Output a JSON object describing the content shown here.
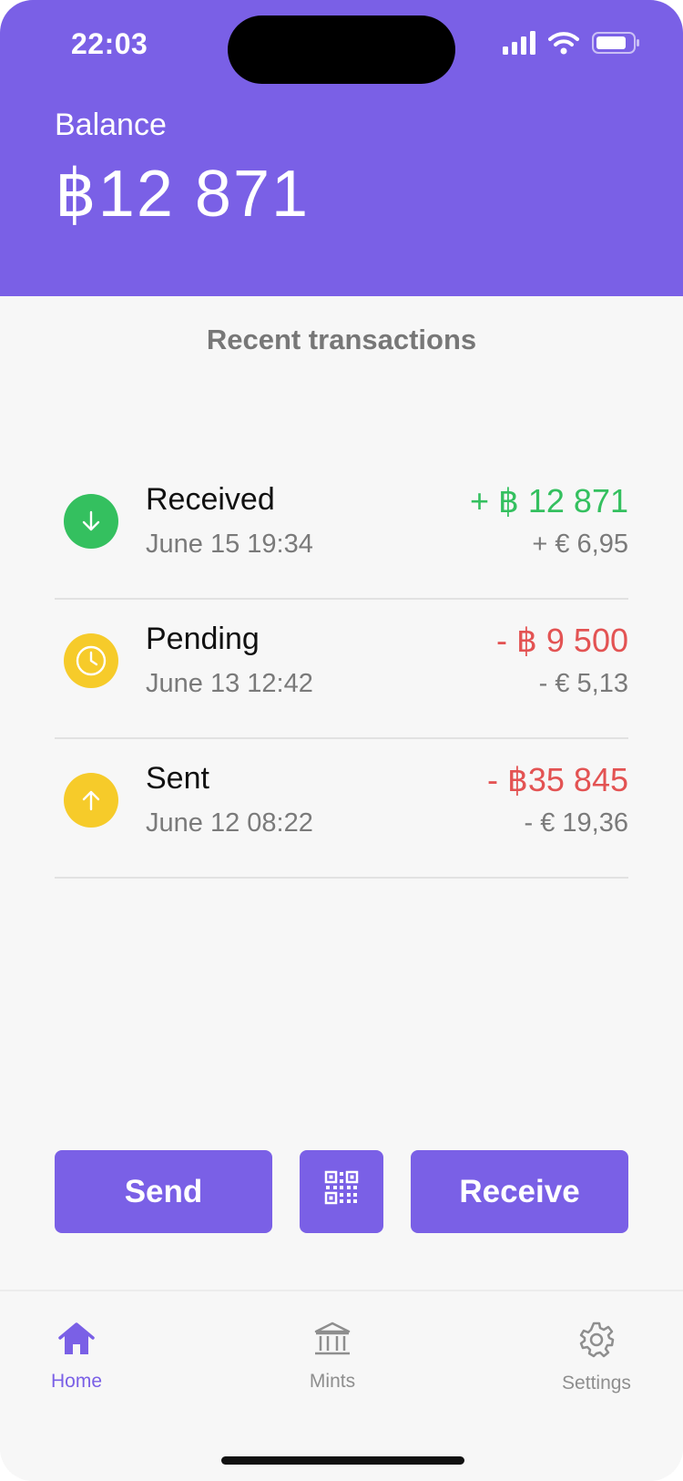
{
  "status_bar": {
    "time": "22:03",
    "icons": [
      "signal-icon",
      "wifi-icon",
      "battery-icon"
    ]
  },
  "header": {
    "balance_label": "Balance",
    "balance_value": "฿12 871"
  },
  "transactions": {
    "title": "Recent transactions",
    "items": [
      {
        "name": "Received",
        "date": "June 15 19:34",
        "amount": "+ ฿ 12 871",
        "fiat": "+ € 6,95",
        "icon": "arrow-down-icon",
        "direction": "incoming"
      },
      {
        "name": "Pending",
        "date": "June 13 12:42",
        "amount": "- ฿ 9 500",
        "fiat": "- € 5,13",
        "icon": "clock-icon",
        "direction": "outgoing"
      },
      {
        "name": "Sent",
        "date": "June 12 08:22",
        "amount": "- ฿35 845",
        "fiat": "- € 19,36",
        "icon": "arrow-up-icon",
        "direction": "outgoing"
      }
    ]
  },
  "actions": {
    "send_label": "Send",
    "qr_icon": "qr-code-icon",
    "receive_label": "Receive"
  },
  "tabbar": {
    "tabs": [
      {
        "label": "Home",
        "icon": "home-icon",
        "active": true
      },
      {
        "label": "Mints",
        "icon": "bank-icon",
        "active": false
      },
      {
        "label": "Settings",
        "icon": "gear-icon",
        "active": false
      }
    ]
  },
  "colors": {
    "accent": "#7A60E6",
    "positive": "#34C05F",
    "negative": "#E35353",
    "pending": "#F6CB2A",
    "muted_text": "#7a7a7a"
  }
}
